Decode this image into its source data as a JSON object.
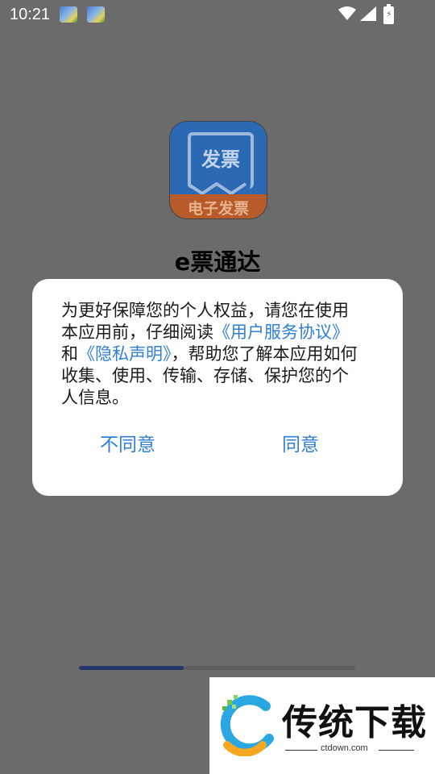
{
  "status_bar": {
    "time": "10:21"
  },
  "app": {
    "icon_top_text": "发票",
    "icon_band_text": "电子发票",
    "name": "e票通达"
  },
  "dialog": {
    "text_part1": "为更好保障您的个人权益，请您在使用本应用前，仔细阅读",
    "link1": "《用户服务协议》",
    "text_part2": "和",
    "link2": "《隐私声明》",
    "text_part3": "，帮助您了解本应用如何收集、使用、传输、存储、保护您的个人信息。",
    "disagree_label": "不同意",
    "agree_label": "同意"
  },
  "progress": {
    "value": 0.38
  },
  "watermark": {
    "title": "传统下载",
    "url": "ctdown.com"
  },
  "colors": {
    "link": "#2f7fd6",
    "overlay": "#6b6b6b",
    "progress": "#24386e"
  }
}
